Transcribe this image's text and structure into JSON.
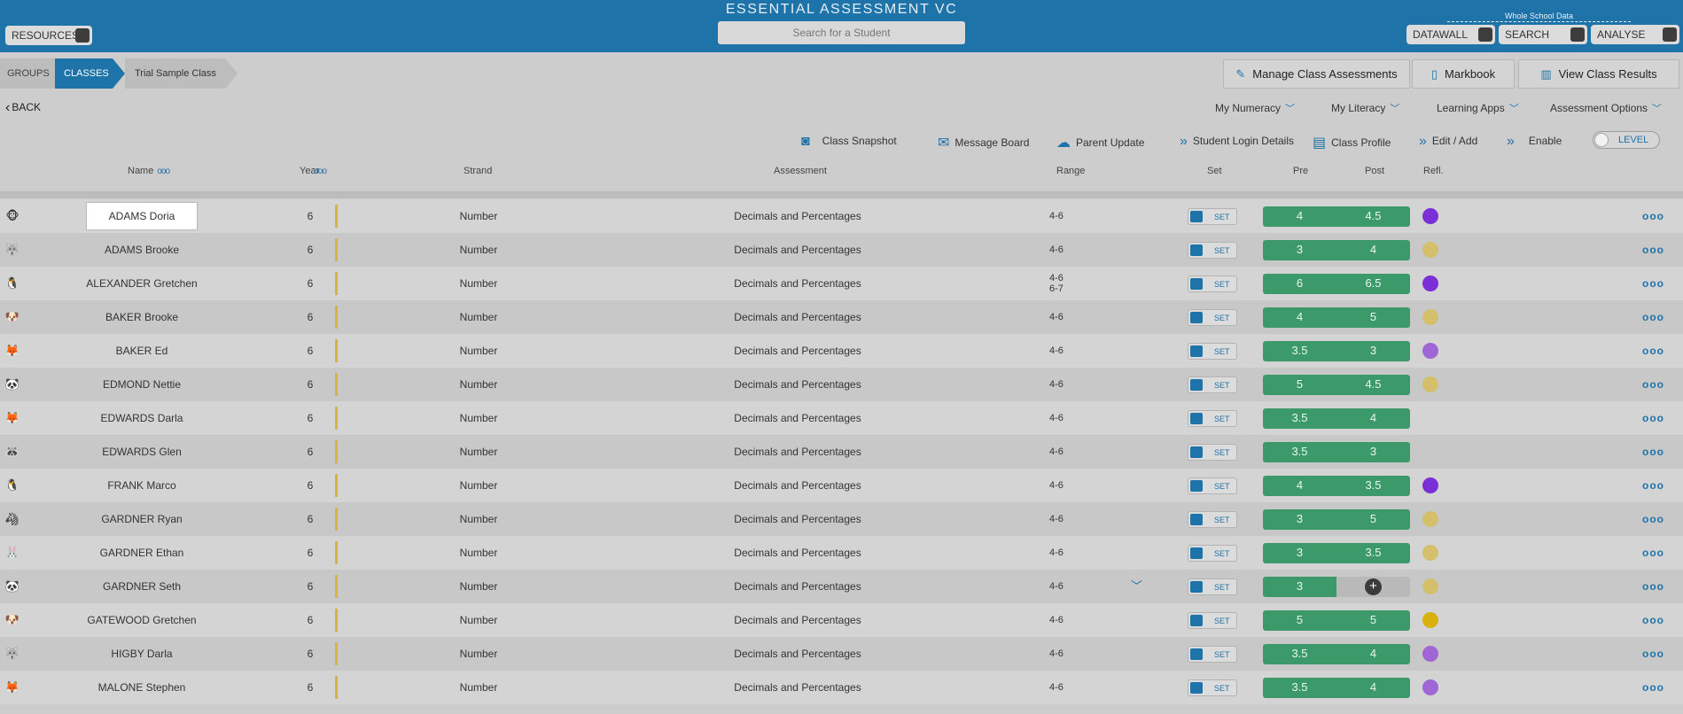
{
  "header": {
    "app_title": "ESSENTIAL ASSESSMENT VC",
    "search_placeholder": "Search for a Student",
    "resources_label": "RESOURCES",
    "whole_school_label": "Whole School Data",
    "datawall_label": "DATAWALL",
    "search_label": "SEARCH",
    "analyse_label": "ANALYSE"
  },
  "breadcrumb": {
    "groups": "GROUPS",
    "classes": "CLASSES",
    "current": "Trial Sample Class"
  },
  "top_buttons": {
    "manage": "Manage Class Assessments",
    "markbook": "Markbook",
    "view_results": "View Class Results"
  },
  "back_label": "BACK",
  "menus": {
    "numeracy": "My Numeracy",
    "literacy": "My Literacy",
    "learning_apps": "Learning Apps",
    "assessment_options": "Assessment Options"
  },
  "toolbar": {
    "snapshot": "Class Snapshot",
    "message_board": "Message Board",
    "parent_update": "Parent Update",
    "login_details": "Student Login Details",
    "class_profile": "Class Profile",
    "edit_add": "Edit / Add",
    "enable": "Enable",
    "level": "LEVEL"
  },
  "columns": {
    "name": "Name",
    "year": "Year",
    "strand": "Strand",
    "assessment": "Assessment",
    "range": "Range",
    "set": "Set",
    "pre": "Pre",
    "post": "Post",
    "refl": "Refl."
  },
  "set_button_label": "SET",
  "more_glyph": "ooo",
  "students": [
    {
      "name": "ADAMS Doria",
      "avatar": "🐵",
      "year": "6",
      "strand": "Number",
      "assessment": "Decimals and Percentages",
      "range": [
        "4-6"
      ],
      "pre": "4",
      "post": "4.5",
      "refl_color": "#7b2fd6",
      "selected": true
    },
    {
      "name": "ADAMS Brooke",
      "avatar": "🐺",
      "year": "6",
      "strand": "Number",
      "assessment": "Decimals and Percentages",
      "range": [
        "4-6"
      ],
      "pre": "3",
      "post": "4",
      "refl_color": "#d4c06a"
    },
    {
      "name": "ALEXANDER Gretchen",
      "avatar": "🐧",
      "year": "6",
      "strand": "Number",
      "assessment": "Decimals and Percentages",
      "range": [
        "4-6",
        "6-7"
      ],
      "pre": "6",
      "post": "6.5",
      "refl_color": "#7b2fd6"
    },
    {
      "name": "BAKER Brooke",
      "avatar": "🐶",
      "year": "6",
      "strand": "Number",
      "assessment": "Decimals and Percentages",
      "range": [
        "4-6"
      ],
      "pre": "4",
      "post": "5",
      "refl_color": "#d4c06a"
    },
    {
      "name": "BAKER Ed",
      "avatar": "🦊",
      "year": "6",
      "strand": "Number",
      "assessment": "Decimals and Percentages",
      "range": [
        "4-6"
      ],
      "pre": "3.5",
      "post": "3",
      "refl_color": "#a066d6"
    },
    {
      "name": "EDMOND Nettie",
      "avatar": "🐼",
      "year": "6",
      "strand": "Number",
      "assessment": "Decimals and Percentages",
      "range": [
        "4-6"
      ],
      "pre": "5",
      "post": "4.5",
      "refl_color": "#d4c06a"
    },
    {
      "name": "EDWARDS Darla",
      "avatar": "🦊",
      "year": "6",
      "strand": "Number",
      "assessment": "Decimals and Percentages",
      "range": [
        "4-6"
      ],
      "pre": "3.5",
      "post": "4",
      "refl_color": ""
    },
    {
      "name": "EDWARDS Glen",
      "avatar": "🦝",
      "year": "6",
      "strand": "Number",
      "assessment": "Decimals and Percentages",
      "range": [
        "4-6"
      ],
      "pre": "3.5",
      "post": "3",
      "refl_color": ""
    },
    {
      "name": "FRANK Marco",
      "avatar": "🐧",
      "year": "6",
      "strand": "Number",
      "assessment": "Decimals and Percentages",
      "range": [
        "4-6"
      ],
      "pre": "4",
      "post": "3.5",
      "refl_color": "#7b2fd6"
    },
    {
      "name": "GARDNER Ryan",
      "avatar": "🦓",
      "year": "6",
      "strand": "Number",
      "assessment": "Decimals and Percentages",
      "range": [
        "4-6"
      ],
      "pre": "3",
      "post": "5",
      "refl_color": "#d4c06a"
    },
    {
      "name": "GARDNER Ethan",
      "avatar": "🐰",
      "year": "6",
      "strand": "Number",
      "assessment": "Decimals and Percentages",
      "range": [
        "4-6"
      ],
      "pre": "3",
      "post": "3.5",
      "refl_color": "#d4c06a"
    },
    {
      "name": "GARDNER Seth",
      "avatar": "🐼",
      "year": "6",
      "strand": "Number",
      "assessment": "Decimals and Percentages",
      "range": [
        "4-6"
      ],
      "pre": "3",
      "post": "",
      "refl_color": "#d4c06a",
      "has_dropdown": true
    },
    {
      "name": "GATEWOOD Gretchen",
      "avatar": "🐶",
      "year": "6",
      "strand": "Number",
      "assessment": "Decimals and Percentages",
      "range": [
        "4-6"
      ],
      "pre": "5",
      "post": "5",
      "refl_color": "#d9b10f"
    },
    {
      "name": "HIGBY Darla",
      "avatar": "🐺",
      "year": "6",
      "strand": "Number",
      "assessment": "Decimals and Percentages",
      "range": [
        "4-6"
      ],
      "pre": "3.5",
      "post": "4",
      "refl_color": "#a066d6"
    },
    {
      "name": "MALONE Stephen",
      "avatar": "🦊",
      "year": "6",
      "strand": "Number",
      "assessment": "Decimals and Percentages",
      "range": [
        "4-6"
      ],
      "pre": "3.5",
      "post": "4",
      "refl_color": "#a066d6"
    }
  ]
}
